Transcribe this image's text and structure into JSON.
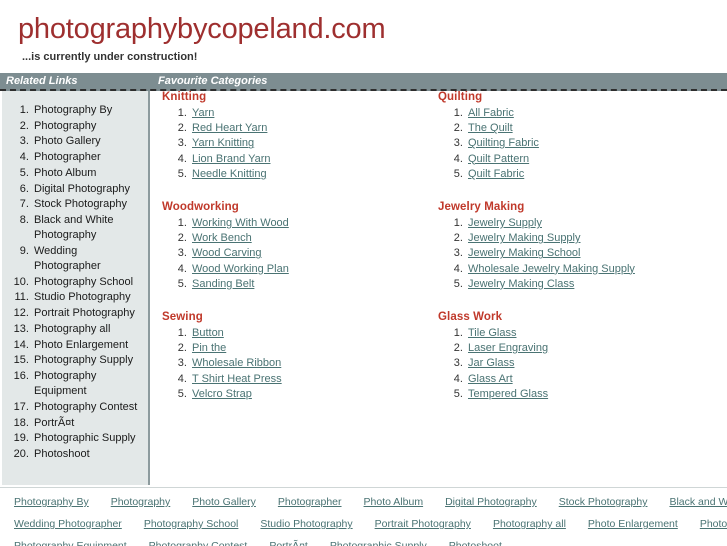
{
  "header": {
    "title": "photographybycopeland.com",
    "tagline": "...is currently under construction!"
  },
  "colors": {
    "title": "#9e2f2f",
    "panel_bar_bg": "#7d8d91",
    "sidebar_bg": "#e3e8e8",
    "heading_red": "#c0392b",
    "link_teal": "#4a7373"
  },
  "panel_bar": {
    "left_label": "Related Links",
    "right_label": "Favourite Categories"
  },
  "sidebar": {
    "items": [
      "Photography By",
      "Photography",
      "Photo Gallery",
      "Photographer",
      "Photo Album",
      "Digital Photography",
      "Stock Photography",
      "Black and White Photography",
      "Wedding Photographer",
      "Photography School",
      "Studio Photography",
      "Portrait Photography",
      "Photography all",
      "Photo Enlargement",
      "Photography Supply",
      "Photography Equipment",
      "Photography Contest",
      "PortrÃ¤t",
      "Photographic Supply",
      "Photoshoot"
    ]
  },
  "categories": {
    "left": [
      {
        "heading": "Knitting",
        "links": [
          "Yarn",
          "Red Heart Yarn",
          "Yarn Knitting",
          "Lion Brand Yarn",
          "Needle Knitting"
        ]
      },
      {
        "heading": "Woodworking",
        "links": [
          "Working With Wood",
          "Work Bench",
          "Wood Carving",
          "Wood Working Plan",
          "Sanding Belt"
        ]
      },
      {
        "heading": "Sewing",
        "links": [
          "Button",
          "Pin the",
          "Wholesale Ribbon",
          "T Shirt Heat Press",
          "Velcro Strap"
        ]
      }
    ],
    "right": [
      {
        "heading": "Quilting",
        "links": [
          "All Fabric",
          "The Quilt",
          "Quilting Fabric",
          "Quilt Pattern",
          "Quilt Fabric"
        ]
      },
      {
        "heading": "Jewelry Making",
        "links": [
          "Jewelry Supply",
          "Jewelry Making Supply",
          "Jewelry Making School",
          "Wholesale Jewelry Making Supply",
          "Jewelry Making Class"
        ]
      },
      {
        "heading": "Glass Work",
        "links": [
          "Tile Glass",
          "Laser Engraving",
          "Jar Glass",
          "Glass Art",
          "Tempered Glass"
        ]
      }
    ]
  },
  "footer": {
    "rows": [
      [
        "Photography By",
        "Photography",
        "Photo Gallery",
        "Photographer",
        "Photo Album",
        "Digital Photography",
        "Stock Photography",
        "Black and White Photography"
      ],
      [
        "Wedding Photographer",
        "Photography School",
        "Studio Photography",
        "Portrait Photography",
        "Photography all",
        "Photo Enlargement",
        "Photography Supply"
      ],
      [
        "Photography Equipment",
        "Photography Contest",
        "PortrÃ¤t",
        "Photographic Supply",
        "Photoshoot"
      ]
    ]
  }
}
